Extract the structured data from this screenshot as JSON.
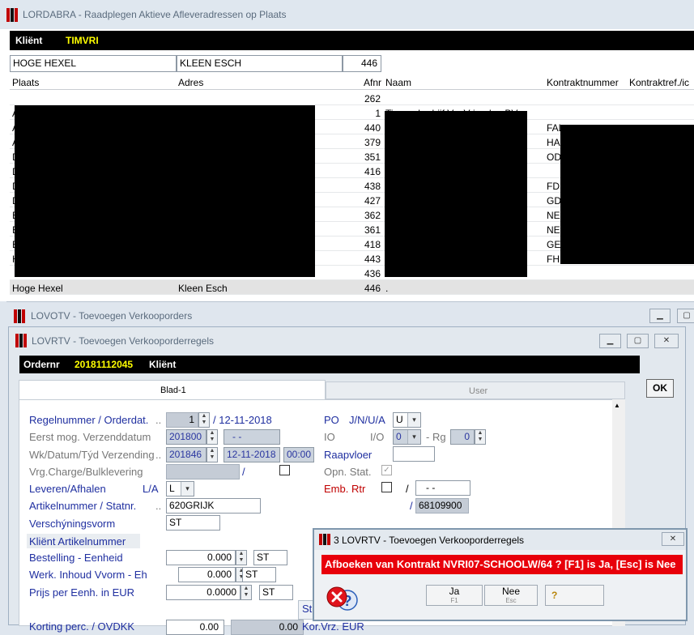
{
  "lordabra": {
    "title": "LORDABRA - Raadplegen Aktieve Afleveradressen op Plaats",
    "client_label": "Kliënt",
    "client_value": "TIMVRI",
    "filter": {
      "plaats": "HOGE HEXEL",
      "adres": "KLEEN ESCH",
      "afnr": "446"
    },
    "columns": [
      "Plaats",
      "Adres",
      "Afnr",
      "Naam",
      "Kontraktnummer",
      "Kontraktref./ic"
    ],
    "rows": [
      {
        "plaats": "",
        "afnr": "262",
        "naam": "",
        "kontrakt": ""
      },
      {
        "plaats": "A",
        "afnr": "1",
        "naam": "Timmerbedrijf V... Vrienden BV",
        "kontrakt": ""
      },
      {
        "plaats": "A",
        "afnr": "440",
        "naam": "",
        "kontrakt": "FAL"
      },
      {
        "plaats": "A",
        "afnr": "379",
        "naam": "",
        "kontrakt": "HAL"
      },
      {
        "plaats": "D",
        "afnr": "351",
        "naam": "",
        "kontrakt": "ODE"
      },
      {
        "plaats": "D",
        "afnr": "416",
        "naam": "",
        "kontrakt": ""
      },
      {
        "plaats": "D",
        "afnr": "438",
        "naam": "",
        "kontrakt": "FDE"
      },
      {
        "plaats": "D",
        "afnr": "427",
        "naam": "",
        "kontrakt": "GDO"
      },
      {
        "plaats": "E",
        "afnr": "362",
        "naam": "",
        "kontrakt": "NEN"
      },
      {
        "plaats": "E",
        "afnr": "361",
        "naam": "",
        "kontrakt": "NEN"
      },
      {
        "plaats": "E",
        "afnr": "418",
        "naam": "",
        "kontrakt": "GER"
      },
      {
        "plaats": "H",
        "afnr": "443",
        "naam": "",
        "kontrakt": "FHE"
      },
      {
        "plaats": "",
        "afnr": "436",
        "naam": "",
        "kontrakt": ""
      },
      {
        "plaats": "Hoge Hexel",
        "adres": "Kleen Esch",
        "afnr": "446",
        "naam": ".",
        "kontrakt": ""
      }
    ]
  },
  "lovotv": {
    "title": "LOVOTV - Toevoegen Verkooporders"
  },
  "lovrtv": {
    "title": "LOVRTV - Toevoegen Verkooporderregels",
    "ordernr_label": "Ordernr",
    "ordernr_value": "20181112045",
    "client_label": "Kliënt",
    "tabs": [
      "Blad-1",
      "User"
    ],
    "ok_label": "OK",
    "fields": {
      "regelnummer_label": "Regelnummer / Orderdat.",
      "regelnummer_dots": "..",
      "regelnummer_value": "1",
      "orderdat_value": "/ 12-11-2018",
      "eerst_label": "Eerst mog. Verzenddatum",
      "eerst_value": "201800",
      "eerst_value2": "- -",
      "wk_label": "Wk/Datum/Týd Verzending",
      "wk_dots": "..",
      "wk_value": "201846",
      "wk_date": "12-11-2018",
      "wk_time": "00:00",
      "vrg_label": "Vrg.Charge/Bulklevering",
      "vrg_slash": "/",
      "leveren_label": "Leveren/Afhalen",
      "la_label": "L/A",
      "la_value": "L",
      "artikel_label": "Artikelnummer / Statnr.",
      "artikel_dots": "..",
      "artikel_value": "620GRIJK",
      "statnr_slash": "/",
      "statnr_value": "68109900",
      "verschijning_label": "Verschýningsvorm",
      "verschijning_value": "ST",
      "klient_artikel_label": "Kliënt Artikelnummer",
      "bestelling_label": "Bestelling - Eenheid",
      "bestelling_value": "0.000",
      "bestelling_unit": "ST",
      "werk_label": "Werk. Inhoud Vvorm - Eh",
      "werk_value": "0.000",
      "werk_unit": "ST",
      "prijs_label": "Prijs per Eenh. in EUR",
      "prijs_value": "0.0000",
      "prijs_unit": "ST",
      "korting_label": "Korting perc. / OVDKK",
      "korting_value": "0.00",
      "korting_value2": "0.00",
      "kor_vrz_label": "Kor.Vrz. EUR",
      "st_label": "St",
      "po_label": "PO",
      "po_sub": "J/N/U/A",
      "po_value": "U",
      "io_label": "IO",
      "io_sub": "I/O",
      "io_value": "0",
      "rg_label": "- Rg",
      "rg_value": "0",
      "raapvloer_label": "Raapvloer",
      "opn_label": "Opn. Stat.",
      "emb_label": "Emb. Rtr",
      "emb_slash": "/",
      "emb_value": "- -"
    }
  },
  "dialog": {
    "title": "3 LOVRTV - Toevoegen Verkooporderregels",
    "message": "Afboeken van Kontrakt NVRI07-SCHOOLW/64 ?  [F1] is Ja, [Esc] is Nee",
    "ja_label": "Ja",
    "ja_key": "F1",
    "nee_label": "Nee",
    "nee_key": "Esc",
    "help_glyph": "?"
  }
}
